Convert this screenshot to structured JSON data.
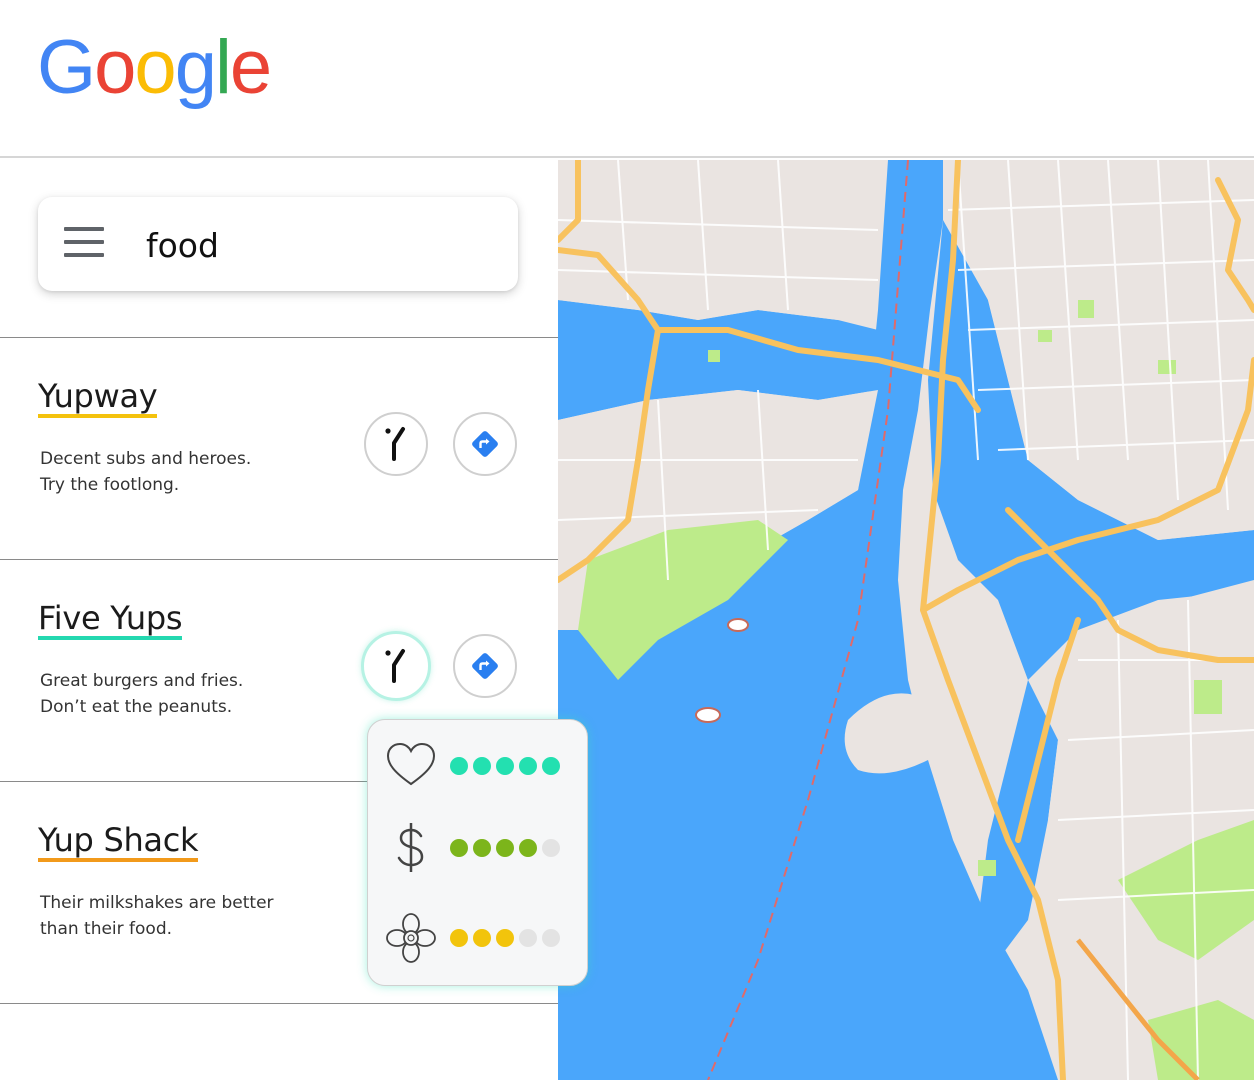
{
  "logo": {
    "text": "Google",
    "letters": [
      {
        "char": "G",
        "color": "#4285F4"
      },
      {
        "char": "o",
        "color": "#EA4335"
      },
      {
        "char": "o",
        "color": "#FBBC05"
      },
      {
        "char": "g",
        "color": "#4285F4"
      },
      {
        "char": "l",
        "color": "#34A853"
      },
      {
        "char": "e",
        "color": "#EA4335"
      }
    ]
  },
  "search": {
    "value": "food",
    "menu_icon": "hamburger-menu-icon"
  },
  "results": [
    {
      "title": "Yupway",
      "underline_color": "#f4c20d",
      "description": [
        "Decent subs and heroes.",
        "Try the footlong."
      ],
      "info_icon": "scale-pin-icon",
      "directions_icon": "directions-icon",
      "info_active": false
    },
    {
      "title": "Five Yups",
      "underline_color": "#24d8b0",
      "description": [
        "Great burgers and fries.",
        "Don’t eat the peanuts."
      ],
      "info_icon": "scale-pin-icon",
      "directions_icon": "directions-icon",
      "info_active": true
    },
    {
      "title": "Yup Shack",
      "underline_color": "#f29a1b",
      "description": [
        "Their milkshakes are better",
        "than their food."
      ],
      "info_icon": "scale-pin-icon",
      "directions_icon": "directions-icon",
      "info_active": false
    }
  ],
  "ratings_popup": {
    "for_result": "Five Yups",
    "rows": [
      {
        "icon": "heart-icon",
        "score": 5,
        "max": 5,
        "color": "#23e0b0"
      },
      {
        "icon": "dollar-icon",
        "score": 4,
        "max": 5,
        "color": "#7cb51b"
      },
      {
        "icon": "flower-icon",
        "score": 3,
        "max": 5,
        "color": "#f2c40c"
      }
    ],
    "empty_color": "#e3e3e3"
  },
  "colors": {
    "water": "#4aa6fb",
    "land": "#eae4e1",
    "park": "#bdeb8a",
    "highway": "#f8c25e",
    "directions_blue": "#2a7ff0"
  }
}
